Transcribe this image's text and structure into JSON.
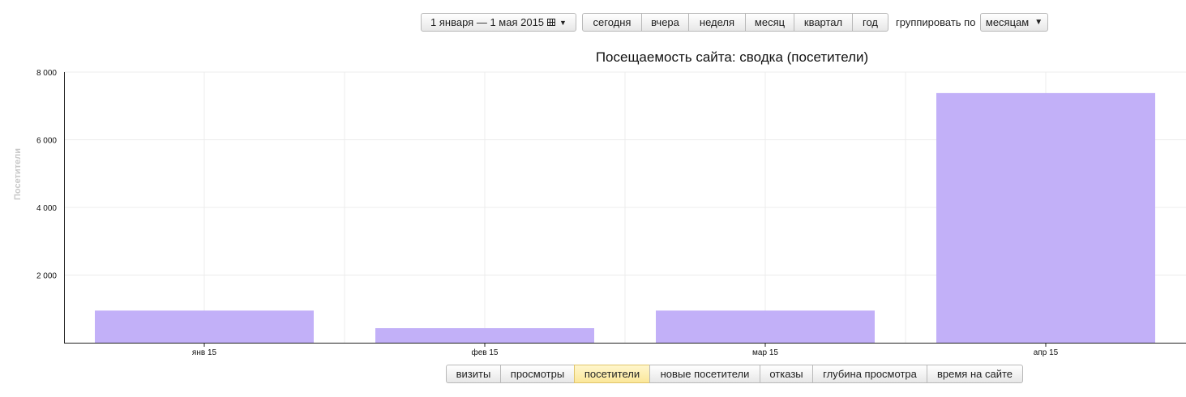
{
  "toolbar": {
    "date_range": "1 января — 1 мая 2015",
    "periods": [
      "сегодня",
      "вчера",
      "неделя",
      "месяц",
      "квартал",
      "год"
    ],
    "group_by_label": "группировать по",
    "group_by_value": "месяцам"
  },
  "metrics": {
    "items": [
      "визиты",
      "просмотры",
      "посетители",
      "новые посетители",
      "отказы",
      "глубина просмотра",
      "время на сайте"
    ],
    "active_index": 2
  },
  "colors": {
    "bar": "#c2b0f8",
    "grid": "#ececec",
    "axis": "#222222",
    "ylabel": "#c8c8c8"
  },
  "chart_data": {
    "type": "bar",
    "title": "Посещаемость сайта: сводка (посетители)",
    "ylabel": "Посетители",
    "xlabel": "",
    "categories": [
      "янв 15",
      "фев 15",
      "мар 15",
      "апр 15"
    ],
    "values": [
      950,
      430,
      950,
      7380
    ],
    "ylim": [
      0,
      8000
    ],
    "yticks": [
      2000,
      4000,
      6000,
      8000
    ],
    "ytick_labels": [
      "2 000",
      "4 000",
      "6 000",
      "8 000"
    ],
    "grid": true,
    "legend": "none"
  }
}
